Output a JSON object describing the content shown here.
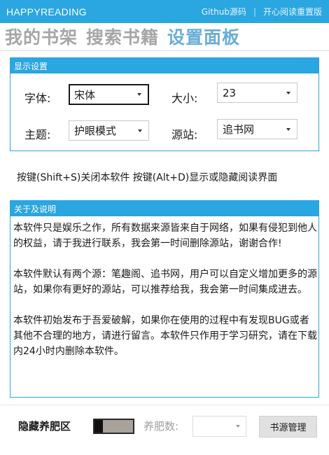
{
  "window": {
    "title": "HAPPYREADING",
    "links": [
      "Github源码",
      "开心阅读重置版"
    ]
  },
  "nav": {
    "tabs": [
      {
        "label": "我的书架",
        "active": false
      },
      {
        "label": "搜索书籍",
        "active": false
      },
      {
        "label": "设置面板",
        "active": true
      }
    ]
  },
  "display_settings": {
    "header": "显示设置",
    "font": {
      "label": "字体:",
      "value": "宋体"
    },
    "size": {
      "label": "大小:",
      "value": "23"
    },
    "theme": {
      "label": "主题:",
      "value": "护眼模式"
    },
    "source": {
      "label": "源站:",
      "value": "追书网"
    }
  },
  "hotkeys": "按键(Shift+S)关闭本软件  按键(Alt+D)显示或隐藏阅读界面",
  "about": {
    "header": "关于及说明",
    "paragraphs": [
      "本软件只是娱乐之作，所有数据来源皆来自于网络，如果有侵犯到他人的权益，请于我进行联系，我会第一时间删除源站，谢谢合作!",
      "本软件默认有两个源：笔趣阁、追书网，用户可以自定义增加更多的源站，如果你有更好的源站，可以推荐给我，我会第一时间集成进去。",
      "本软件初始发布于吾爱破解，如果你在使用的过程中有发现BUG或者其他不合理的地方，请进行留言。本软件只作用于学习研究，请在下载内24小时内删除本软件。"
    ]
  },
  "bottom": {
    "hide_label": "隐藏养肥区",
    "hide_toggle_on": false,
    "fat_label": "养肥数:",
    "fat_value": "",
    "source_manage_button": "书源管理"
  },
  "colors": {
    "accent": "#2aa6e0",
    "active_tab": "#6aaed6",
    "inactive_tab": "#a6a6a6"
  }
}
